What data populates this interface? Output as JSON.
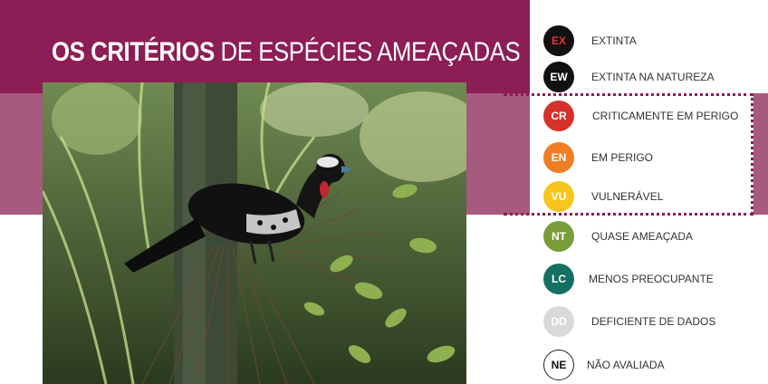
{
  "title": {
    "bold": "OS CRITÉRIOS",
    "rest": "DE ESPÉCIES AMEAÇADAS"
  },
  "photo": {
    "subject": "black bird with red wattle perched in palm",
    "icon": "bird-photo"
  },
  "categories": [
    {
      "code": "EX",
      "label": "EXTINTA",
      "bg": "#111111",
      "fg": "#e8342a",
      "border": ""
    },
    {
      "code": "EW",
      "label": "EXTINTA NA NATUREZA",
      "bg": "#111111",
      "fg": "#ffffff",
      "border": ""
    },
    {
      "code": "CR",
      "label": "CRITICAMENTE  EM PERIGO",
      "bg": "#d6322b",
      "fg": "#ffffff",
      "border": ""
    },
    {
      "code": "EN",
      "label": "EM PERIGO",
      "bg": "#ef7d24",
      "fg": "#ffffff",
      "border": ""
    },
    {
      "code": "VU",
      "label": "VULNERÁVEL",
      "bg": "#f7c51b",
      "fg": "#ffffff",
      "border": ""
    },
    {
      "code": "NT",
      "label": "QUASE AMEAÇADA",
      "bg": "#7a9d3c",
      "fg": "#ffffff",
      "border": ""
    },
    {
      "code": "LC",
      "label": "MENOS PREOCUPANTE",
      "bg": "#137062",
      "fg": "#ffffff",
      "border": ""
    },
    {
      "code": "DD",
      "label": "DEFICIENTE DE DADOS",
      "bg": "#d9d9d9",
      "fg": "#ffffff",
      "border": ""
    },
    {
      "code": "NE",
      "label": "NÃO AVALIADA",
      "bg": "#ffffff",
      "fg": "#111111",
      "border": "#222222"
    }
  ],
  "colors": {
    "title_band": "#8c1d55",
    "mid_band": "#a65a80",
    "dotted_frame": "#8c1d55"
  }
}
